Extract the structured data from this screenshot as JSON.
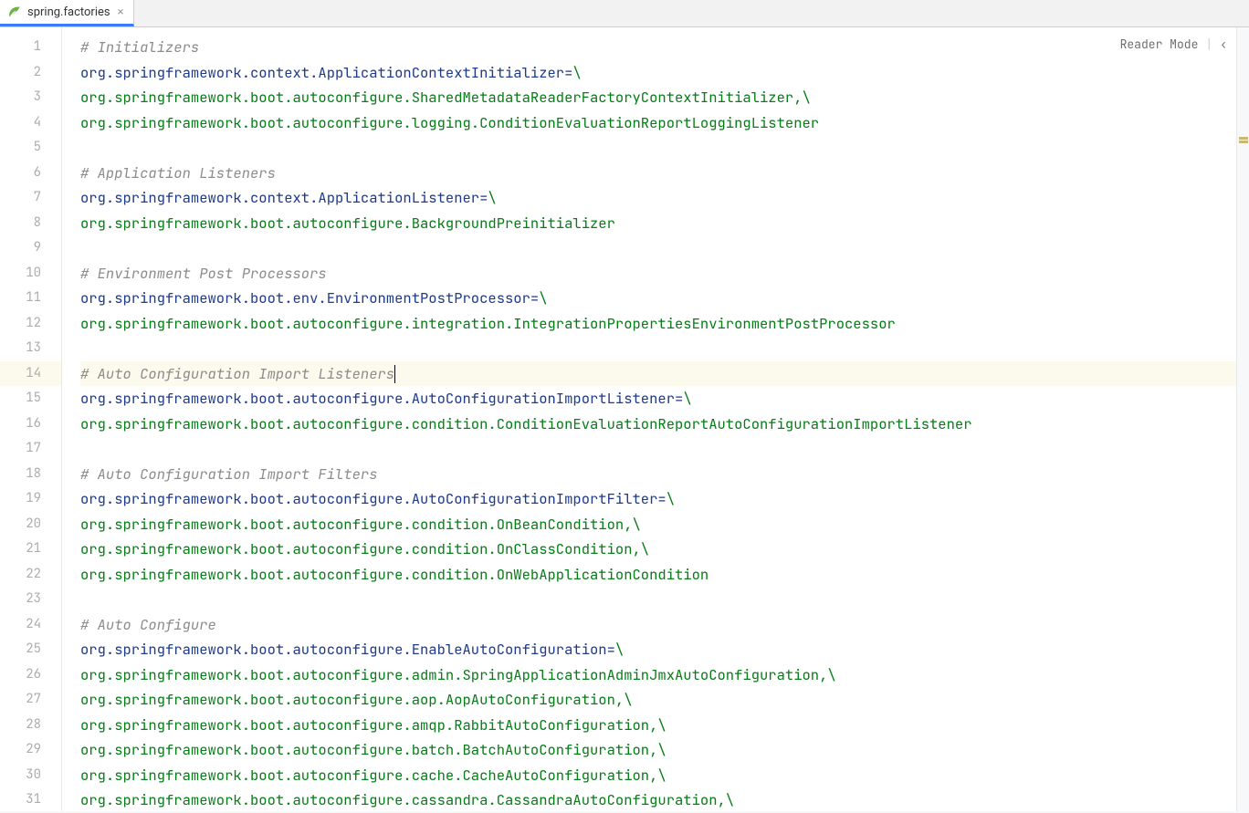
{
  "tab": {
    "filename": "spring.factories",
    "close_glyph": "×"
  },
  "reader_mode_label": "Reader Mode",
  "reader_mode_chevron": "‹",
  "code": {
    "lines": [
      {
        "n": 1,
        "type": "comment",
        "text": "# Initializers"
      },
      {
        "n": 2,
        "type": "kv",
        "key": "org.springframework.context.ApplicationContextInitializer",
        "sep": "=",
        "val": "\\"
      },
      {
        "n": 3,
        "type": "value",
        "text": "org.springframework.boot.autoconfigure.SharedMetadataReaderFactoryContextInitializer,\\"
      },
      {
        "n": 4,
        "type": "value",
        "text": "org.springframework.boot.autoconfigure.logging.ConditionEvaluationReportLoggingListener"
      },
      {
        "n": 5,
        "type": "blank",
        "text": ""
      },
      {
        "n": 6,
        "type": "comment",
        "text": "# Application Listeners"
      },
      {
        "n": 7,
        "type": "kv",
        "key": "org.springframework.context.ApplicationListener",
        "sep": "=",
        "val": "\\"
      },
      {
        "n": 8,
        "type": "value",
        "text": "org.springframework.boot.autoconfigure.BackgroundPreinitializer"
      },
      {
        "n": 9,
        "type": "blank",
        "text": ""
      },
      {
        "n": 10,
        "type": "comment",
        "text": "# Environment Post Processors"
      },
      {
        "n": 11,
        "type": "kv",
        "key": "org.springframework.boot.env.EnvironmentPostProcessor",
        "sep": "=",
        "val": "\\"
      },
      {
        "n": 12,
        "type": "value",
        "text": "org.springframework.boot.autoconfigure.integration.IntegrationPropertiesEnvironmentPostProcessor"
      },
      {
        "n": 13,
        "type": "blank",
        "text": ""
      },
      {
        "n": 14,
        "type": "comment",
        "text": "# Auto Configuration Import Listeners",
        "highlighted": true,
        "caret": true
      },
      {
        "n": 15,
        "type": "kv",
        "key": "org.springframework.boot.autoconfigure.AutoConfigurationImportListener",
        "sep": "=",
        "val": "\\"
      },
      {
        "n": 16,
        "type": "value",
        "text": "org.springframework.boot.autoconfigure.condition.ConditionEvaluationReportAutoConfigurationImportListener"
      },
      {
        "n": 17,
        "type": "blank",
        "text": ""
      },
      {
        "n": 18,
        "type": "comment",
        "text": "# Auto Configuration Import Filters"
      },
      {
        "n": 19,
        "type": "kv",
        "key": "org.springframework.boot.autoconfigure.AutoConfigurationImportFilter",
        "sep": "=",
        "val": "\\"
      },
      {
        "n": 20,
        "type": "value",
        "text": "org.springframework.boot.autoconfigure.condition.OnBeanCondition,\\"
      },
      {
        "n": 21,
        "type": "value",
        "text": "org.springframework.boot.autoconfigure.condition.OnClassCondition,\\"
      },
      {
        "n": 22,
        "type": "value",
        "text": "org.springframework.boot.autoconfigure.condition.OnWebApplicationCondition"
      },
      {
        "n": 23,
        "type": "blank",
        "text": ""
      },
      {
        "n": 24,
        "type": "comment",
        "text": "# Auto Configure"
      },
      {
        "n": 25,
        "type": "kv",
        "key": "org.springframework.boot.autoconfigure.EnableAutoConfiguration",
        "sep": "=",
        "val": "\\"
      },
      {
        "n": 26,
        "type": "value",
        "text": "org.springframework.boot.autoconfigure.admin.SpringApplicationAdminJmxAutoConfiguration,\\"
      },
      {
        "n": 27,
        "type": "value",
        "text": "org.springframework.boot.autoconfigure.aop.AopAutoConfiguration,\\"
      },
      {
        "n": 28,
        "type": "value",
        "text": "org.springframework.boot.autoconfigure.amqp.RabbitAutoConfiguration,\\"
      },
      {
        "n": 29,
        "type": "value",
        "text": "org.springframework.boot.autoconfigure.batch.BatchAutoConfiguration,\\"
      },
      {
        "n": 30,
        "type": "value",
        "text": "org.springframework.boot.autoconfigure.cache.CacheAutoConfiguration,\\"
      },
      {
        "n": 31,
        "type": "value",
        "text": "org.springframework.boot.autoconfigure.cassandra.CassandraAutoConfiguration,\\"
      }
    ]
  }
}
